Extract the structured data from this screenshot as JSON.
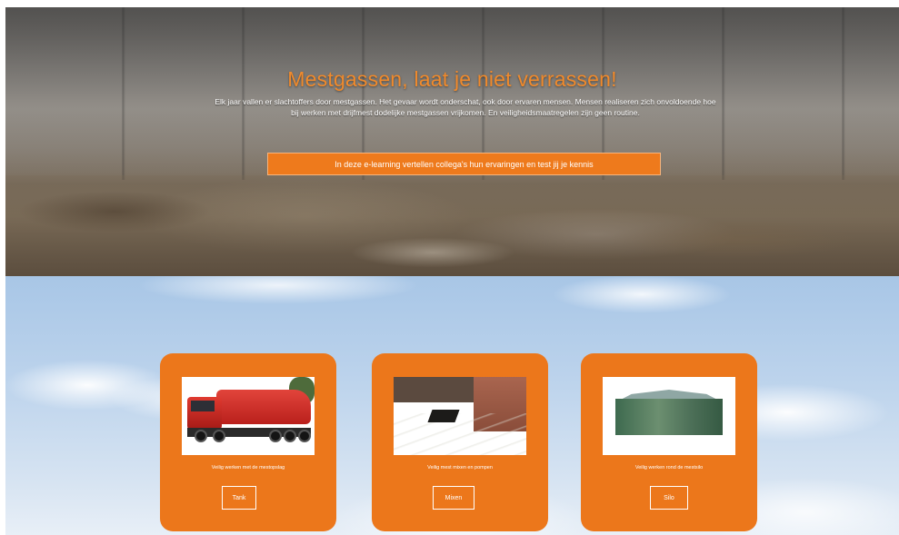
{
  "hero": {
    "title": "Mestgassen, laat je niet verrassen!",
    "text": "Elk jaar vallen er slachtoffers door mestgassen. Het gevaar wordt onderschat, ook door ervaren mensen. Mensen realiseren zich onvoldoende hoe bij werken met drijfmest dodelijke mestgassen vrijkomen. En veiligheidsmaatregelen zijn geen routine.",
    "cta_label": "In deze e-learning vertellen collega's hun ervaringen en test jij je kennis"
  },
  "cards": [
    {
      "photo_alt": "tankwagen",
      "caption": "Veilig werken met de mestopslag",
      "button_label": "Tank"
    },
    {
      "photo_alt": "mestput",
      "caption": "Veilig mest mixen en pompen",
      "button_label": "Mixen"
    },
    {
      "photo_alt": "mestsilo",
      "caption": "Veilig werken rond de mestsilo",
      "button_label": "Silo"
    }
  ],
  "colors": {
    "accent": "#ec771b",
    "title": "#f08a2c"
  }
}
